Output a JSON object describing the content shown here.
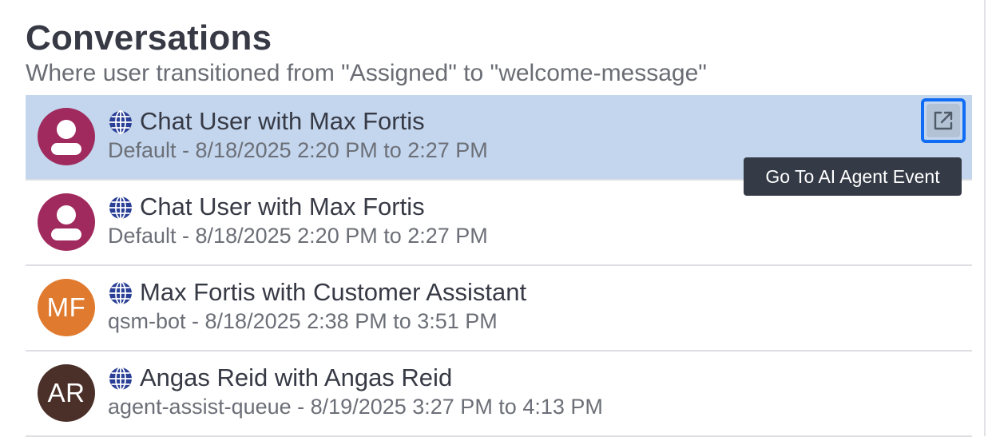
{
  "header": {
    "title": "Conversations",
    "subtitle": "Where user transitioned from \"Assigned\" to \"welcome-message\""
  },
  "conversations": [
    {
      "title": "Chat User with Max Fortis",
      "details": "Default - 8/18/2025 2:20 PM to 2:27 PM",
      "avatar_type": "person-icon",
      "avatar_initials": "",
      "avatar_color": "#a02a5d",
      "channel_icon": "globe-icon",
      "selected": true
    },
    {
      "title": "Chat User with Max Fortis",
      "details": "Default - 8/18/2025 2:20 PM to 2:27 PM",
      "avatar_type": "person-icon",
      "avatar_initials": "",
      "avatar_color": "#a02a5d",
      "channel_icon": "globe-icon",
      "selected": false
    },
    {
      "title": "Max Fortis with Customer Assistant",
      "details": "qsm-bot - 8/18/2025 2:38 PM to 3:51 PM",
      "avatar_type": "initials",
      "avatar_initials": "MF",
      "avatar_color": "#e07a2e",
      "channel_icon": "globe-icon",
      "selected": false
    },
    {
      "title": "Angas Reid with Angas Reid",
      "details": "agent-assist-queue - 8/19/2025 3:27 PM to 4:13 PM",
      "avatar_type": "initials",
      "avatar_initials": "AR",
      "avatar_color": "#4b3029",
      "channel_icon": "globe-icon",
      "selected": false
    }
  ],
  "row_action": {
    "icon": "external-link-icon",
    "tooltip": "Go To AI Agent Event"
  },
  "colors": {
    "selected_row": "#c3d6ee",
    "focus_ring": "#0f6cf5",
    "globe": "#2a3f96"
  }
}
